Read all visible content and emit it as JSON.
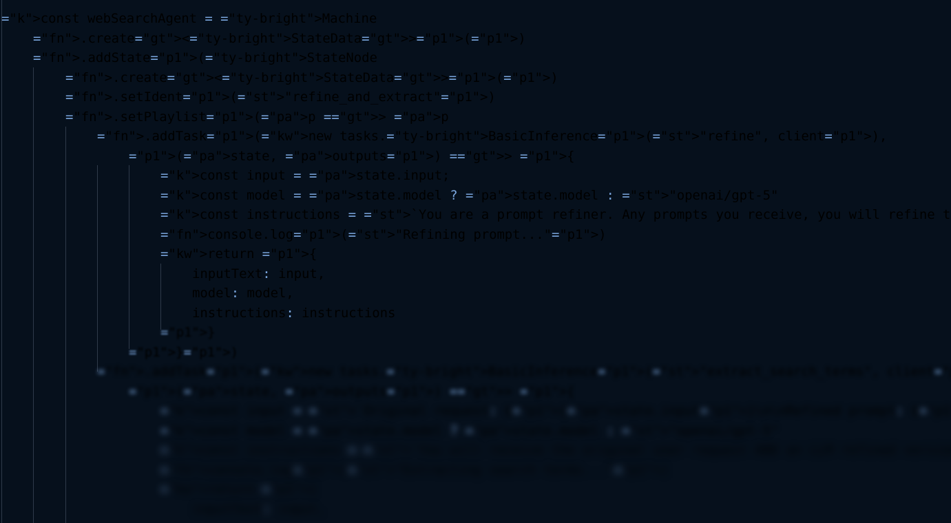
{
  "lines": [
    "const webSearchAgent = Machine",
    ".create<StateData>()",
    ".addState(StateNode",
    ".create<StateData>()",
    ".setIdent(\"refine_and_extract\")",
    ".setPlaylist(p => p",
    ".addTask(new tasks.BasicInference(\"refine\", client),",
    "(state, outputs) => {",
    "const input = state.input;",
    "const model = state.model ? state.model : \"openai/gpt-5\"",
    "const instructions = `You are a prompt refiner. Any prompts you receive, you will refine to improve",
    "console.log(\"Refining prompt...\")",
    "return {",
    "inputText: input,",
    "model: model,",
    "instructions: instructions",
    "}",
    "})",
    ".addTask(new tasks.BasicInference(\"extract_search_terms\", client),",
    "(state, outputs) => {",
    "const input = `Original request: ${state.input}\\n\\nRefined prompt: ${state.refinedInput}`;",
    "const model = state.model ? state.model : \"openai/gpt-5\"",
    "const instructions = `You will receive the original user request AND an LLM refined version of the p",
    "console.log(\"Extracting search terms...\")",
    "return {",
    "inputText: input,"
  ],
  "colors": {
    "background": "#06101c",
    "keyword": "#9f8fff",
    "string": "#76d36d",
    "type": "#f4e3a3",
    "bracket_yellow": "#f5cf4e",
    "bracket_purple": "#cc73ff",
    "bracket_blue": "#5aa7ff"
  }
}
